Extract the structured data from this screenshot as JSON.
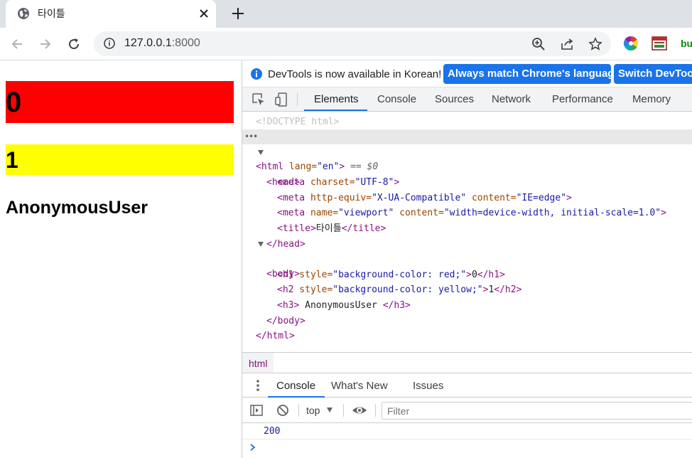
{
  "browser": {
    "tab": {
      "title": "타이틀",
      "favicon": "globe-icon"
    },
    "address": {
      "host": "127.0.0.1",
      "port": ":8000"
    },
    "extension_label": "bu"
  },
  "page": {
    "h1": {
      "text": "0",
      "bg": "#ff0000"
    },
    "h2": {
      "text": "1",
      "bg": "#ffff00"
    },
    "h3": {
      "text": "AnonymousUser"
    }
  },
  "devtools": {
    "infobar": {
      "message": "DevTools is now available in Korean!",
      "btn_match": "Always match Chrome's language",
      "btn_switch": "Switch DevTools"
    },
    "tabs": [
      "Elements",
      "Console",
      "Sources",
      "Network",
      "Performance",
      "Memory"
    ],
    "active_tab": "Elements",
    "dom": {
      "doctype": "<!DOCTYPE html>",
      "html_open": "<html",
      "html_lang_attr": " lang=",
      "html_lang_val": "\"en\"",
      "html_close_br": ">",
      "selected_marker": " == $0",
      "head_open": "<head>",
      "meta_charset": {
        "tag": "<meta",
        "attr": " charset=",
        "val": "\"UTF-8\"",
        "end": ">"
      },
      "meta_compat": {
        "tag": "<meta",
        "attr1": " http-equiv=",
        "val1": "\"X-UA-Compatible\"",
        "attr2": " content=",
        "val2": "\"IE=edge\"",
        "end": ">"
      },
      "meta_viewport": {
        "tag": "<meta",
        "attr1": " name=",
        "val1": "\"viewport\"",
        "attr2": " content=",
        "val2": "\"width=device-width, initial-scale=1.0\"",
        "end": ">"
      },
      "title": {
        "open": "<title>",
        "text": "타이틀",
        "close": "</title>"
      },
      "head_close": "</head>",
      "body_open": "<body>",
      "h1_line": {
        "tag": "<h1",
        "attr": " style=",
        "val": "\"background-color: red;\"",
        "end": ">",
        "text": "0",
        "close": "</h1>"
      },
      "h2_line": {
        "tag": "<h2",
        "attr": " style=",
        "val": "\"background-color: yellow;\"",
        "end": ">",
        "text": "1",
        "close": "</h2>"
      },
      "h3_line": {
        "open": "<h3>",
        "text": " AnonymousUser ",
        "close": "</h3>"
      },
      "body_close": "</body>",
      "html_close": "</html>"
    },
    "breadcrumb": "html",
    "drawer_tabs": [
      "Console",
      "What's New",
      "Issues"
    ],
    "console": {
      "context": "top",
      "filter_placeholder": "Filter",
      "output": "200"
    }
  },
  "colors": {
    "accent": "#1a73e8",
    "tag": "#881280",
    "attr": "#994500",
    "value": "#1a1aa6"
  }
}
